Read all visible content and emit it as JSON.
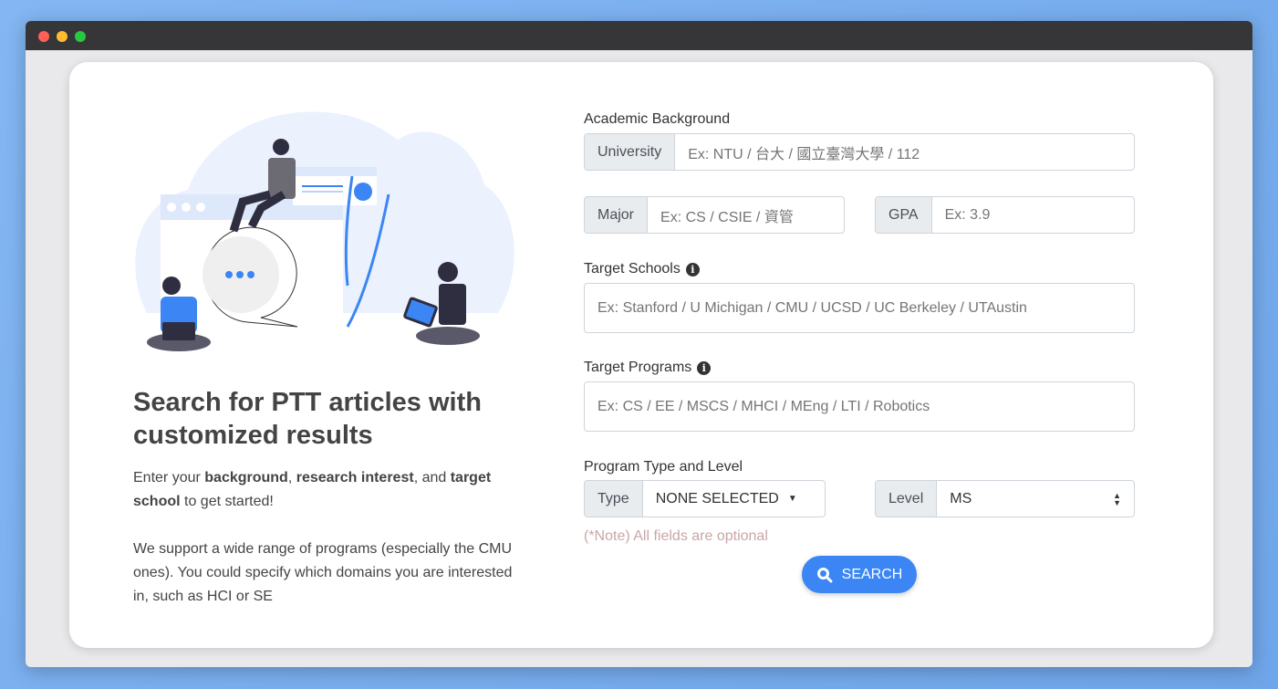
{
  "hero": {
    "title": "Search for PTT articles with customized results",
    "intro_parts": [
      "Enter your ",
      "background",
      ", ",
      "research interest",
      ", and ",
      "target school",
      " to get started!"
    ],
    "support": "We support a wide range of programs (especially the CMU ones). You could specify which domains you are interested in, such as HCI or SE"
  },
  "form": {
    "academic_label": "Academic Background",
    "university": {
      "addon": "University",
      "placeholder": "Ex: NTU / 台大 / 國立臺灣大學 / 112"
    },
    "major": {
      "addon": "Major",
      "placeholder": "Ex: CS / CSIE / 資管"
    },
    "gpa": {
      "addon": "GPA",
      "placeholder": "Ex: 3.9"
    },
    "schools": {
      "label": "Target Schools",
      "placeholder": "Ex: Stanford / U Michigan / CMU / UCSD / UC Berkeley / UTAustin"
    },
    "programs": {
      "label": "Target Programs",
      "placeholder": "Ex: CS / EE / MSCS / MHCI / MEng / LTI / Robotics"
    },
    "program_label": "Program Type and Level",
    "type": {
      "addon": "Type",
      "value": "NONE SELECTED"
    },
    "level": {
      "addon": "Level",
      "value": "MS"
    },
    "note": "(*Note) All fields are optional",
    "search": "SEARCH"
  },
  "colors": {
    "accent": "#3b86f4",
    "note": "#c9a6a6"
  }
}
